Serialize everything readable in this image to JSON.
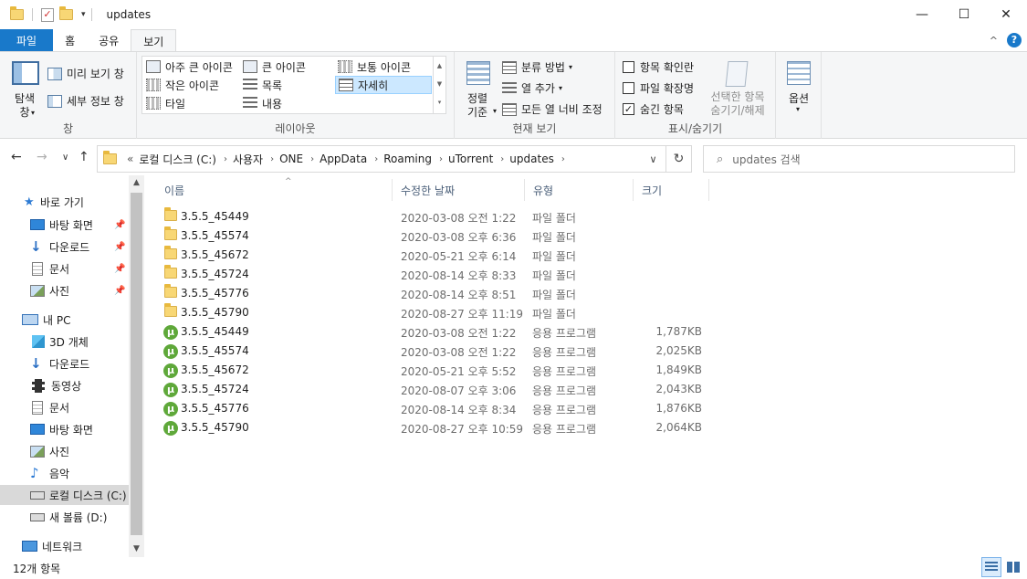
{
  "window": {
    "title": "updates",
    "controls": {
      "minimize": "—",
      "maximize": "☐",
      "close": "✕"
    }
  },
  "ribbon_tabs": [
    {
      "label": "파일"
    },
    {
      "label": "홈"
    },
    {
      "label": "공유"
    },
    {
      "label": "보기"
    }
  ],
  "ribbon": {
    "pane": {
      "nav_pane_label": "탐색 창",
      "preview_label": "미리 보기 창",
      "details_label": "세부 정보 창",
      "group_label": "창"
    },
    "layout": {
      "items": [
        "아주 큰 아이콘",
        "큰 아이콘",
        "보통 아이콘",
        "작은 아이콘",
        "목록",
        "자세히",
        "타일",
        "내용"
      ],
      "selected": "자세히",
      "group_label": "레이아웃"
    },
    "current_view": {
      "sort_label": "정렬 기준",
      "group_by_label": "분류 방법",
      "add_columns_label": "열 추가",
      "fit_columns_label": "모든 열 너비 조정",
      "group_label": "현재 보기"
    },
    "show_hide": {
      "item_checkboxes": {
        "label": "항목 확인란",
        "checked": false
      },
      "file_extensions": {
        "label": "파일 확장명",
        "checked": false
      },
      "hidden_items": {
        "label": "숨긴 항목",
        "checked": true
      },
      "hide_selected_label": "선택한 항목 숨기기/해제",
      "group_label": "표시/숨기기"
    },
    "options_label": "옵션"
  },
  "address_bar": {
    "overflow": "«",
    "segments": [
      "로컬 디스크 (C:)",
      "사용자",
      "ONE",
      "AppData",
      "Roaming",
      "uTorrent",
      "updates"
    ]
  },
  "search": {
    "placeholder": "updates 검색"
  },
  "nav_pane": {
    "quick_access": "바로 가기",
    "quick_items": [
      "바탕 화면",
      "다운로드",
      "문서",
      "사진"
    ],
    "this_pc": "내 PC",
    "pc_items": [
      "3D 개체",
      "다운로드",
      "동영상",
      "문서",
      "바탕 화면",
      "사진",
      "음악",
      "로컬 디스크 (C:)",
      "새 볼륨 (D:)"
    ],
    "network": "네트워크",
    "selected": "로컬 디스크 (C:)"
  },
  "columns": {
    "name": "이름",
    "date": "수정한 날짜",
    "type": "유형",
    "size": "크기"
  },
  "files": [
    {
      "name": "3.5.5_45449",
      "date": "2020-03-08 오전 1:22",
      "type": "파일 폴더",
      "size": "",
      "kind": "folder"
    },
    {
      "name": "3.5.5_45574",
      "date": "2020-03-08 오후 6:36",
      "type": "파일 폴더",
      "size": "",
      "kind": "folder"
    },
    {
      "name": "3.5.5_45672",
      "date": "2020-05-21 오후 6:14",
      "type": "파일 폴더",
      "size": "",
      "kind": "folder"
    },
    {
      "name": "3.5.5_45724",
      "date": "2020-08-14 오후 8:33",
      "type": "파일 폴더",
      "size": "",
      "kind": "folder"
    },
    {
      "name": "3.5.5_45776",
      "date": "2020-08-14 오후 8:51",
      "type": "파일 폴더",
      "size": "",
      "kind": "folder"
    },
    {
      "name": "3.5.5_45790",
      "date": "2020-08-27 오후 11:19",
      "type": "파일 폴더",
      "size": "",
      "kind": "folder"
    },
    {
      "name": "3.5.5_45449",
      "date": "2020-03-08 오전 1:22",
      "type": "응용 프로그램",
      "size": "1,787KB",
      "kind": "app"
    },
    {
      "name": "3.5.5_45574",
      "date": "2020-03-08 오전 1:22",
      "type": "응용 프로그램",
      "size": "2,025KB",
      "kind": "app"
    },
    {
      "name": "3.5.5_45672",
      "date": "2020-05-21 오후 5:52",
      "type": "응용 프로그램",
      "size": "1,849KB",
      "kind": "app"
    },
    {
      "name": "3.5.5_45724",
      "date": "2020-08-07 오후 3:06",
      "type": "응용 프로그램",
      "size": "2,043KB",
      "kind": "app"
    },
    {
      "name": "3.5.5_45776",
      "date": "2020-08-14 오후 8:34",
      "type": "응용 프로그램",
      "size": "1,876KB",
      "kind": "app"
    },
    {
      "name": "3.5.5_45790",
      "date": "2020-08-27 오후 10:59",
      "type": "응용 프로그램",
      "size": "2,064KB",
      "kind": "app"
    }
  ],
  "status": {
    "count_text": "12개 항목"
  }
}
